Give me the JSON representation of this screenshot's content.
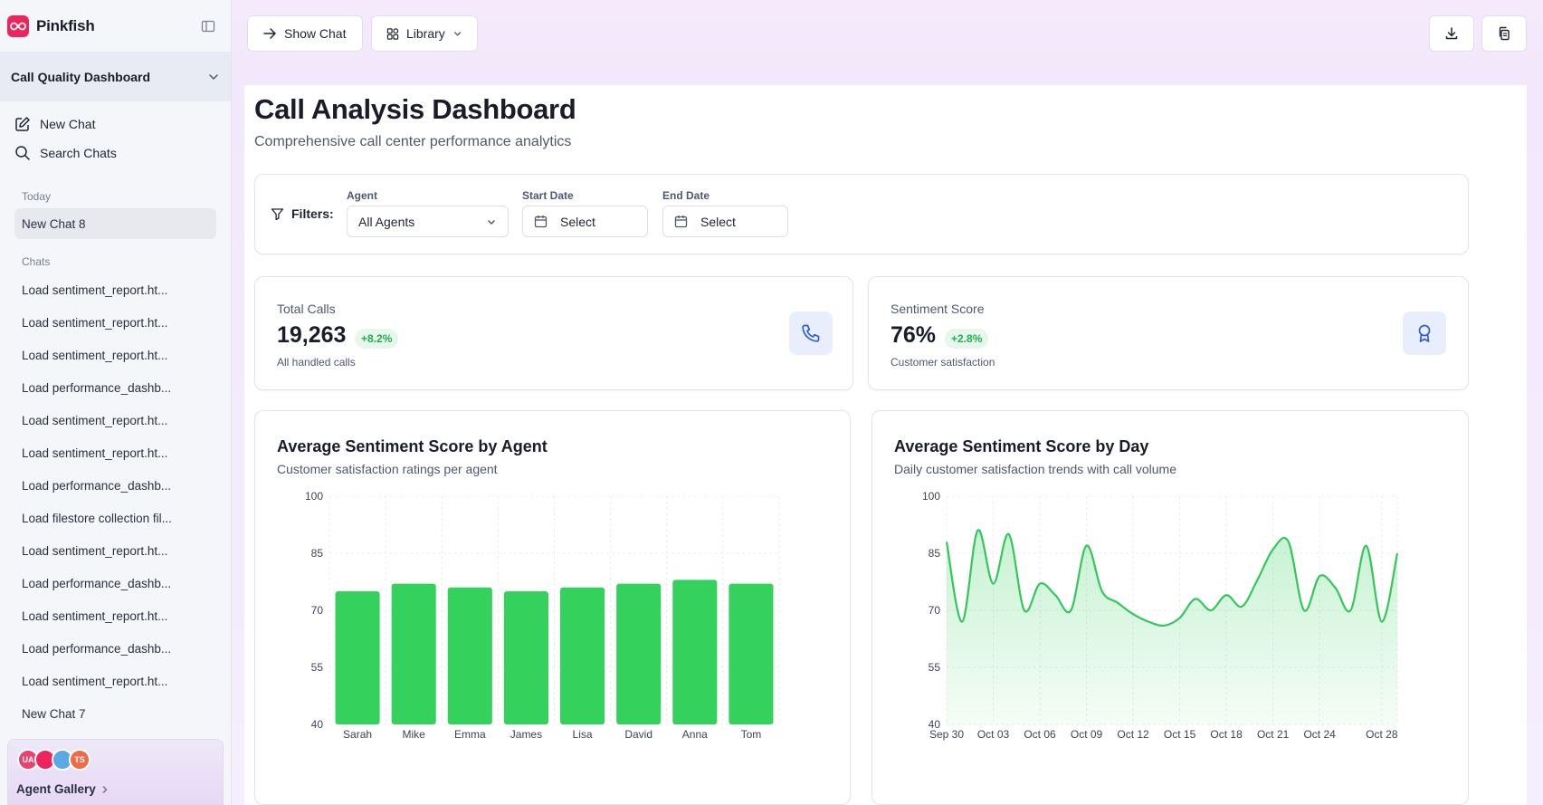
{
  "app": {
    "brand_name": "Pinkfish",
    "workspace": "Call Quality Dashboard"
  },
  "sidebar": {
    "new_chat": "New Chat",
    "search_chats": "Search Chats",
    "today_label": "Today",
    "today_items": [
      "New Chat 8"
    ],
    "chats_label": "Chats",
    "chat_items": [
      "Load sentiment_report.ht...",
      "Load sentiment_report.ht...",
      "Load sentiment_report.ht...",
      "Load performance_dashb...",
      "Load sentiment_report.ht...",
      "Load sentiment_report.ht...",
      "Load performance_dashb...",
      "Load filestore collection fil...",
      "Load sentiment_report.ht...",
      "Load performance_dashb...",
      "Load sentiment_report.ht...",
      "Load performance_dashb...",
      "Load sentiment_report.ht...",
      "New Chat 7"
    ],
    "avatars": [
      {
        "initials": "UA",
        "color": "#e8436f"
      },
      {
        "initials": "",
        "color": "#f0245c"
      },
      {
        "initials": "",
        "color": "#5aa9e6"
      },
      {
        "initials": "TS",
        "color": "#ef6b45"
      }
    ],
    "agent_gallery": "Agent Gallery"
  },
  "topbar": {
    "show_chat": "Show Chat",
    "library": "Library"
  },
  "dashboard": {
    "title": "Call Analysis Dashboard",
    "subtitle": "Comprehensive call center performance analytics",
    "filters": {
      "label": "Filters:",
      "agent_label": "Agent",
      "agent_value": "All Agents",
      "start_label": "Start Date",
      "start_value": "Select",
      "end_label": "End Date",
      "end_value": "Select"
    },
    "stats": [
      {
        "label": "Total Calls",
        "value": "19,263",
        "change": "+8.2%",
        "note": "All handled calls",
        "icon": "phone-icon"
      },
      {
        "label": "Sentiment Score",
        "value": "76%",
        "change": "+2.8%",
        "note": "Customer satisfaction",
        "icon": "award-icon"
      }
    ],
    "bar_chart": {
      "title": "Average Sentiment Score by Agent",
      "subtitle": "Customer satisfaction ratings per agent"
    },
    "line_chart": {
      "title": "Average Sentiment Score by Day",
      "subtitle": "Daily customer satisfaction trends with call volume"
    }
  },
  "colors": {
    "accent": "#f0245c",
    "bar": "#34d15c",
    "line": "#33c75c",
    "positive": "#1fae4f"
  },
  "chart_data": [
    {
      "type": "bar",
      "title": "Average Sentiment Score by Agent",
      "categories": [
        "Sarah",
        "Mike",
        "Emma",
        "James",
        "Lisa",
        "David",
        "Anna",
        "Tom"
      ],
      "values": [
        75,
        77,
        76,
        75,
        76,
        77,
        78,
        77
      ],
      "yticks": [
        40,
        55,
        70,
        85,
        100
      ],
      "ylim": [
        40,
        100
      ],
      "grid": true
    },
    {
      "type": "area",
      "title": "Average Sentiment Score by Day",
      "x": [
        "Sep 30",
        "Oct 01",
        "Oct 02",
        "Oct 03",
        "Oct 04",
        "Oct 05",
        "Oct 06",
        "Oct 07",
        "Oct 08",
        "Oct 09",
        "Oct 10",
        "Oct 11",
        "Oct 12",
        "Oct 13",
        "Oct 14",
        "Oct 15",
        "Oct 16",
        "Oct 17",
        "Oct 18",
        "Oct 19",
        "Oct 20",
        "Oct 21",
        "Oct 22",
        "Oct 23",
        "Oct 24",
        "Oct 25",
        "Oct 26",
        "Oct 27",
        "Oct 28",
        "Oct 29"
      ],
      "values": [
        88,
        67,
        91,
        77,
        90,
        70,
        77,
        74,
        70,
        87,
        75,
        72,
        69,
        67,
        66,
        68,
        73,
        70,
        74,
        71,
        78,
        86,
        88,
        70,
        79,
        76,
        70,
        87,
        67,
        85
      ],
      "xticks": [
        "Sep 30",
        "Oct 03",
        "Oct 06",
        "Oct 09",
        "Oct 12",
        "Oct 15",
        "Oct 18",
        "Oct 21",
        "Oct 24",
        "Oct 28"
      ],
      "yticks": [
        40,
        55,
        70,
        85,
        100
      ],
      "ylim": [
        40,
        100
      ],
      "grid": true
    }
  ]
}
